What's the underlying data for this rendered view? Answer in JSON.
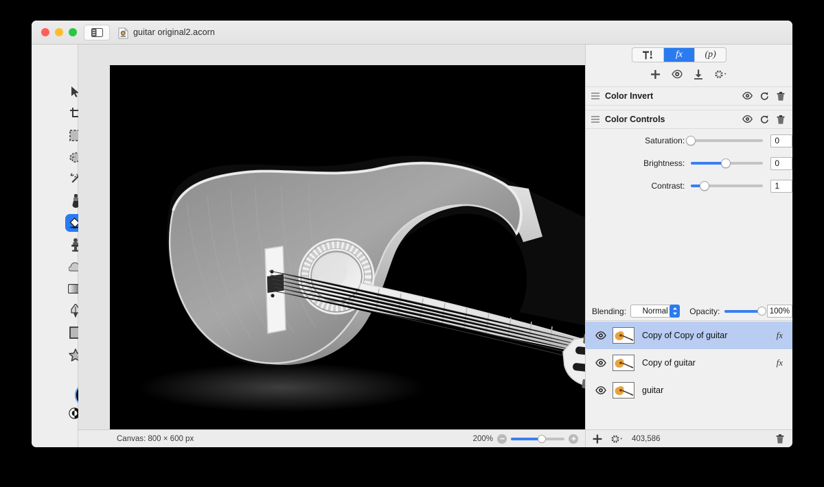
{
  "window": {
    "title": "guitar original2.acorn",
    "traffic_lights": [
      "close",
      "minimize",
      "zoom"
    ],
    "sidebar_toggle": "sidebar-toggle",
    "doc_icon": "acorn-document-icon"
  },
  "tools": {
    "rows": [
      [
        {
          "name": "move-tool",
          "icon": "arrow-pointer",
          "selected": false
        },
        {
          "name": "zoom-tool",
          "icon": "magnifier-plus",
          "selected": false
        }
      ],
      [
        {
          "name": "crop-tool",
          "icon": "crop",
          "selected": false,
          "badge": true
        },
        {
          "name": "transform-tool",
          "icon": "arrows-expand",
          "selected": false
        }
      ],
      [
        {
          "name": "rectangular-select-tool",
          "icon": "marquee-rect",
          "selected": false
        },
        {
          "name": "elliptical-select-tool",
          "icon": "marquee-ellipse",
          "selected": false
        }
      ],
      [
        {
          "name": "lasso-select-tool",
          "icon": "lasso",
          "selected": false
        },
        {
          "name": "polygon-select-tool",
          "icon": "polygon-lasso",
          "selected": false
        }
      ],
      [
        {
          "name": "magic-wand-tool",
          "icon": "magic-wand",
          "selected": false
        },
        {
          "name": "instant-alpha-tool",
          "icon": "magic-wand-dots",
          "selected": false
        }
      ],
      [
        {
          "name": "brush-tool",
          "icon": "paint-brush",
          "selected": false
        },
        {
          "name": "pencil-tool",
          "icon": "pencil",
          "selected": false
        }
      ],
      [
        {
          "name": "paint-bucket-tool",
          "icon": "paint-bucket",
          "selected": true
        },
        {
          "name": "eraser-tool",
          "icon": "eraser",
          "selected": false
        }
      ],
      [
        {
          "name": "clone-stamp-tool",
          "icon": "clone-stamp",
          "selected": false
        },
        {
          "name": "smudge-tool",
          "icon": "smudge-splat",
          "selected": false
        }
      ],
      [
        {
          "name": "dodge-tool",
          "icon": "cloud-burn",
          "selected": false
        },
        {
          "name": "burn-tool",
          "icon": "sun-dodge",
          "selected": false
        }
      ],
      [
        {
          "name": "gradient-tool",
          "icon": "gradient",
          "selected": false
        },
        {
          "name": "text-tool",
          "icon": "text-t",
          "selected": false,
          "badge": true
        }
      ],
      [
        {
          "name": "bezier-pen-tool",
          "icon": "pen-nib",
          "selected": false,
          "badge": true
        },
        {
          "name": "line-tool",
          "icon": "line-diagonal",
          "selected": false
        }
      ],
      [
        {
          "name": "rectangle-shape-tool",
          "icon": "square",
          "selected": false
        },
        {
          "name": "ellipse-shape-tool",
          "icon": "circle",
          "selected": false
        }
      ],
      [
        {
          "name": "star-shape-tool",
          "icon": "star",
          "selected": false
        },
        {
          "name": "arrow-shape-tool",
          "icon": "arrow-up",
          "selected": false
        }
      ]
    ],
    "colors": {
      "foreground": "#070707",
      "background": "#ffffff",
      "swap_icon": "swap-colors-icon",
      "picker_icon": "color-picker-loupe-icon",
      "selection_ring": "#5a9dfb"
    }
  },
  "canvas": {
    "background": "#000000",
    "content_name": "grayscale-inverted-acoustic-guitar",
    "zoom_percent": "200%",
    "size_label": "Canvas: 800 × 600 px"
  },
  "statusbar": {
    "zoom_out_icon": "zoom-out-icon",
    "zoom_in_icon": "zoom-in-icon"
  },
  "inspector": {
    "segments": [
      {
        "name": "tools-tab",
        "icon": "hammer-tool-icon",
        "label": "",
        "active": false
      },
      {
        "name": "filters-tab",
        "label": "fx",
        "active": true
      },
      {
        "name": "presets-tab",
        "label": "(p)",
        "active": false
      }
    ],
    "toolbar": [
      {
        "name": "add-filter-button",
        "icon": "plus-icon"
      },
      {
        "name": "filter-preview-button",
        "icon": "filter-eye-icon"
      },
      {
        "name": "save-preset-button",
        "icon": "download-icon"
      },
      {
        "name": "filter-settings-button",
        "icon": "gear-dropdown-icon"
      }
    ],
    "filters": [
      {
        "name": "Color Invert",
        "params": []
      },
      {
        "name": "Color Controls",
        "params": [
          {
            "label": "Saturation:",
            "value": "0",
            "fill_pct": 0,
            "knob_pct": 0
          },
          {
            "label": "Brightness:",
            "value": "0",
            "fill_pct": 48,
            "knob_pct": 48
          },
          {
            "label": "Contrast:",
            "value": "1",
            "fill_pct": 19,
            "knob_pct": 19
          }
        ]
      }
    ],
    "filter_row_actions": [
      "eye-icon",
      "reset-icon",
      "delete-icon"
    ]
  },
  "layers": {
    "blending_label": "Blending:",
    "blending_value": "Normal",
    "opacity_label": "Opacity:",
    "opacity_value": "100%",
    "items": [
      {
        "name": "Copy of Copy of guitar",
        "visible": true,
        "selected": true,
        "fx": "fx"
      },
      {
        "name": "Copy of guitar",
        "visible": true,
        "selected": false,
        "fx": "fx"
      },
      {
        "name": "guitar",
        "visible": true,
        "selected": false,
        "fx": ""
      }
    ],
    "bottom_bar": {
      "add_icon": "plus-icon",
      "settings_icon": "gear-dropdown-icon",
      "count": "403,586",
      "delete_icon": "trash-icon"
    }
  }
}
